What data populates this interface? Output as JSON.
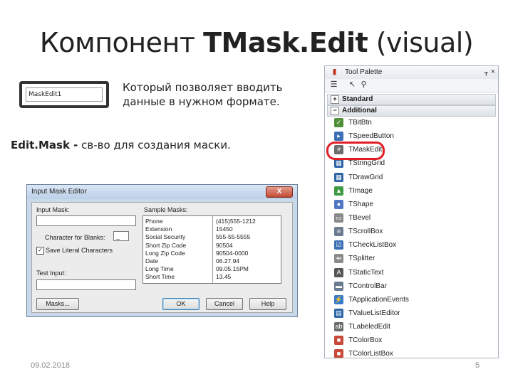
{
  "slide": {
    "title_prefix": "Компонент ",
    "title_bold": "TMask.Edit",
    "title_suffix": " (visual)",
    "demo_text": "MaskEdit1",
    "desc_line1": "Который позволяет вводить",
    "desc_line2": "данные в нужном формате.",
    "editmask_bold": "Edit.Mask -",
    "editmask_text": " св-во для создания маски.",
    "footer_date": "09.02.2018",
    "footer_page": "5"
  },
  "dialog": {
    "title": "Input Mask Editor",
    "close": "X",
    "input_mask_label": "Input Mask:",
    "input_mask_value": "",
    "blanks_label": "Character for Blanks:",
    "blanks_value": "_",
    "save_literal_label": "Save Literal Characters",
    "save_literal_checked": "✓",
    "test_input_label": "Test Input:",
    "test_input_value": "",
    "sample_masks_label": "Sample Masks:",
    "samples": [
      {
        "name": "Phone",
        "value": "(415)555-1212"
      },
      {
        "name": "Extension",
        "value": "15450"
      },
      {
        "name": "Social Security",
        "value": "555-55-5555"
      },
      {
        "name": "Short Zip Code",
        "value": "90504"
      },
      {
        "name": "Long Zip Code",
        "value": "90504-0000"
      },
      {
        "name": "Date",
        "value": "06.27.94"
      },
      {
        "name": "Long Time",
        "value": "09.05.15PM"
      },
      {
        "name": "Short Time",
        "value": "13.45"
      }
    ],
    "masks_button": "Masks...",
    "ok_button": "OK",
    "cancel_button": "Cancel",
    "help_button": "Help"
  },
  "palette": {
    "title": "Tool Palette",
    "pin": "ᚁ",
    "close": "×",
    "categories": [
      {
        "sign": "+",
        "label": "Standard"
      },
      {
        "sign": "−",
        "label": "Additional"
      }
    ],
    "items": [
      {
        "name": "TBitBtn",
        "icon": "bitbtn-icon",
        "color": "#4f8f3a",
        "glyph": "✓"
      },
      {
        "name": "TSpeedButton",
        "icon": "speedbutton-icon",
        "color": "#3b6fb5",
        "glyph": "▸"
      },
      {
        "name": "TMaskEdit",
        "icon": "maskedit-icon",
        "color": "#6b6b6b",
        "glyph": "#"
      },
      {
        "name": "TStringGrid",
        "icon": "stringgrid-icon",
        "color": "#2f66a8",
        "glyph": "▦"
      },
      {
        "name": "TDrawGrid",
        "icon": "drawgrid-icon",
        "color": "#2f66a8",
        "glyph": "▦"
      },
      {
        "name": "TImage",
        "icon": "image-icon",
        "color": "#3e9b43",
        "glyph": "▲"
      },
      {
        "name": "TShape",
        "icon": "shape-icon",
        "color": "#5077c4",
        "glyph": "●"
      },
      {
        "name": "TBevel",
        "icon": "bevel-icon",
        "color": "#8a8a8a",
        "glyph": "▭"
      },
      {
        "name": "TScrollBox",
        "icon": "scrollbox-icon",
        "color": "#6c7c90",
        "glyph": "≡"
      },
      {
        "name": "TCheckListBox",
        "icon": "checklistbox-icon",
        "color": "#3b6fb5",
        "glyph": "☑"
      },
      {
        "name": "TSplitter",
        "icon": "splitter-icon",
        "color": "#8a8a8a",
        "glyph": "⇹"
      },
      {
        "name": "TStaticText",
        "icon": "statictext-icon",
        "color": "#555555",
        "glyph": "A"
      },
      {
        "name": "TControlBar",
        "icon": "controlbar-icon",
        "color": "#6c7c90",
        "glyph": "▬"
      },
      {
        "name": "TApplicationEvents",
        "icon": "applicationevents-icon",
        "color": "#3a7bc8",
        "glyph": "⚡"
      },
      {
        "name": "TValueListEditor",
        "icon": "valuelisteditor-icon",
        "color": "#2f66a8",
        "glyph": "▤"
      },
      {
        "name": "TLabeledEdit",
        "icon": "labelededit-icon",
        "color": "#6b6b6b",
        "glyph": "ab"
      },
      {
        "name": "TColorBox",
        "icon": "colorbox-icon",
        "color": "#c94a3a",
        "glyph": "■"
      },
      {
        "name": "TColorListBox",
        "icon": "colorlistbox-icon",
        "color": "#c94a3a",
        "glyph": "■"
      }
    ]
  },
  "colors": {
    "highlight": "#e21d25",
    "dialog_frame": "#c9d9ec",
    "close_button": "#c24b35"
  }
}
